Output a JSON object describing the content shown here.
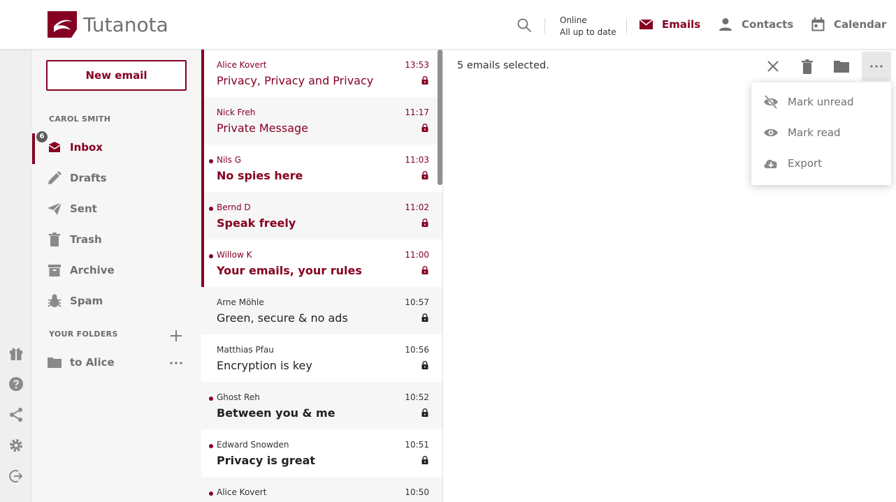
{
  "colors": {
    "brand": "#850122",
    "muted": "#707070",
    "badge": "#5a5a5a"
  },
  "header": {
    "logo_text": "Tutanota",
    "status_line1": "Online",
    "status_line2": "All up to date",
    "nav": {
      "emails": "Emails",
      "contacts": "Contacts",
      "calendar": "Calendar"
    }
  },
  "sidebar": {
    "new_email_label": "New email",
    "account_label": "CAROL SMITH",
    "folders": [
      {
        "label": "Inbox",
        "icon": "inbox-icon",
        "badge": "6"
      },
      {
        "label": "Drafts",
        "icon": "pencil-icon"
      },
      {
        "label": "Sent",
        "icon": "paper-plane-icon"
      },
      {
        "label": "Trash",
        "icon": "trash-icon"
      },
      {
        "label": "Archive",
        "icon": "archive-icon"
      },
      {
        "label": "Spam",
        "icon": "bug-icon"
      }
    ],
    "your_folders_label": "YOUR FOLDERS",
    "custom_folders": [
      {
        "label": "to Alice",
        "icon": "folder-icon"
      }
    ]
  },
  "mails": [
    {
      "sender": "Alice Kovert",
      "time": "13:53",
      "subject": "Privacy, Privacy and Privacy",
      "selected": true,
      "unread": false
    },
    {
      "sender": "Nick Freh",
      "time": "11:17",
      "subject": "Private Message",
      "selected": true,
      "unread": false
    },
    {
      "sender": "Nils G",
      "time": "11:03",
      "subject": "No spies here",
      "selected": true,
      "unread": true
    },
    {
      "sender": "Bernd D",
      "time": "11:02",
      "subject": "Speak freely",
      "selected": true,
      "unread": true
    },
    {
      "sender": "Willow K",
      "time": "11:00",
      "subject": "Your emails, your rules",
      "selected": true,
      "unread": true
    },
    {
      "sender": "Arne Möhle",
      "time": "10:57",
      "subject": "Green, secure & no ads",
      "selected": false,
      "unread": false
    },
    {
      "sender": "Matthias Pfau",
      "time": "10:56",
      "subject": "Encryption is key",
      "selected": false,
      "unread": false
    },
    {
      "sender": "Ghost Reh",
      "time": "10:52",
      "subject": "Between you & me",
      "selected": false,
      "unread": true
    },
    {
      "sender": "Edward Snowden",
      "time": "10:51",
      "subject": "Privacy is great",
      "selected": false,
      "unread": true
    },
    {
      "sender": "Alice Kovert",
      "time": "10:50",
      "subject": "",
      "selected": false,
      "unread": true
    }
  ],
  "main": {
    "selection_text": "5 emails selected.",
    "menu": [
      {
        "label": "Mark unread",
        "icon": "eye-off-icon"
      },
      {
        "label": "Mark read",
        "icon": "eye-icon"
      },
      {
        "label": "Export",
        "icon": "cloud-download-icon"
      }
    ]
  }
}
